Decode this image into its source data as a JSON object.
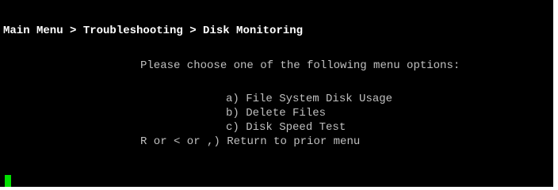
{
  "terminal": {
    "breadcrumb": "Main Menu > Troubleshooting > Disk Monitoring",
    "prompt": "Please choose one of the following menu options:",
    "options": [
      {
        "key": "a)",
        "label": "File System Disk Usage"
      },
      {
        "key": "b)",
        "label": "Delete Files"
      },
      {
        "key": "c)",
        "label": "Disk Speed Test"
      },
      {
        "key": "R or < or ,)",
        "label": "Return to prior menu"
      }
    ],
    "colors": {
      "background": "#000000",
      "text": "#c0c0c0",
      "header_text": "#ffffff",
      "cursor": "#00e000"
    }
  }
}
